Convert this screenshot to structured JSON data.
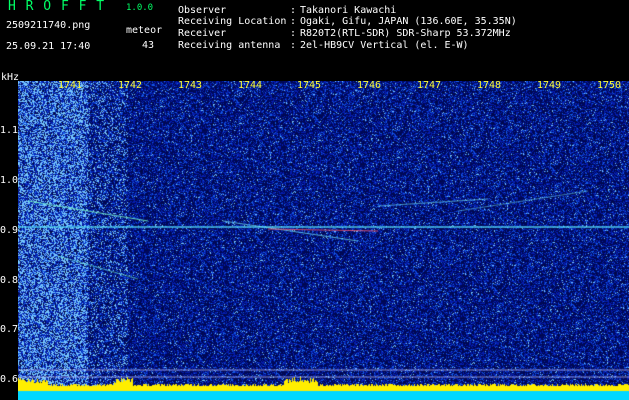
{
  "app": {
    "title": "H R O F F T",
    "version": "1.0.0"
  },
  "capture": {
    "filename": "2509211740.png",
    "datetime": "25.09.21 17:40",
    "meteor_label": "meteor",
    "meteor_count": "43"
  },
  "info": [
    {
      "key": "Observer",
      "value": "Takanori Kawachi"
    },
    {
      "key": "Receiving Location",
      "value": "Ogaki, Gifu, JAPAN (136.60E, 35.35N)"
    },
    {
      "key": "Receiver",
      "value": "R820T2(RTL-SDR) SDR-Sharp 53.372MHz"
    },
    {
      "key": "Receiving antenna",
      "value": "2el-HB9CV Vertical (el. E-W)"
    }
  ],
  "colors": {
    "background": "#000000",
    "noise": "#0a22b8",
    "signal": "#33ffee",
    "hot": "#ff3355",
    "meter": "#ffee00",
    "baseline": "#00d8ff"
  },
  "chart_data": {
    "type": "heatmap",
    "ylabel": "kHz",
    "yticks": [
      "0.6",
      "0.7",
      "0.8",
      "0.9",
      "1.0",
      "1.1"
    ],
    "xticks": [
      "1741",
      "1742",
      "1743",
      "1744",
      "1745",
      "1746",
      "1747",
      "1748",
      "1749",
      "1750"
    ],
    "ylim": [
      0.57,
      1.2
    ]
  }
}
